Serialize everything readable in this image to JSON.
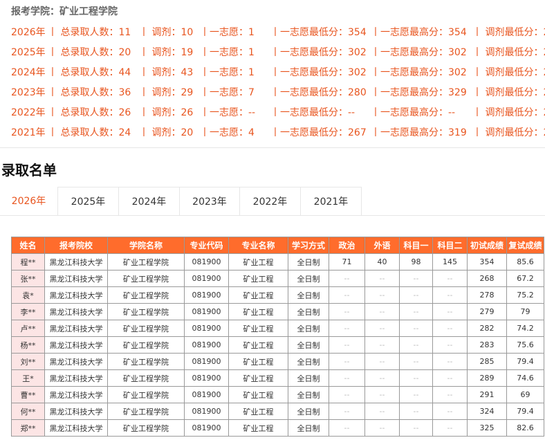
{
  "college_label": "报考学院：矿业工程学院",
  "summary": [
    {
      "year": "2026年",
      "total": "丨 总录取人数：11",
      "adjust": "丨 调剂：10",
      "first": "丨一志愿：1",
      "first_min": "丨一志愿最低分：354",
      "first_max": "丨一志愿最高分：354",
      "adjust_min": "丨 调剂最低分：2"
    },
    {
      "year": "2025年",
      "total": "丨 总录取人数：20",
      "adjust": "丨 调剂：19",
      "first": "丨一志愿：1",
      "first_min": "丨一志愿最低分：302",
      "first_max": "丨一志愿最高分：302",
      "adjust_min": "丨 调剂最低分：2"
    },
    {
      "year": "2024年",
      "total": "丨 总录取人数：44",
      "adjust": "丨 调剂：43",
      "first": "丨一志愿：1",
      "first_min": "丨一志愿最低分：302",
      "first_max": "丨一志愿最高分：302",
      "adjust_min": "丨 调剂最低分：2"
    },
    {
      "year": "2023年",
      "total": "丨 总录取人数：36",
      "adjust": "丨 调剂：29",
      "first": "丨一志愿：7",
      "first_min": "丨一志愿最低分：280",
      "first_max": "丨一志愿最高分：329",
      "adjust_min": "丨 调剂最低分：2"
    },
    {
      "year": "2022年",
      "total": "丨 总录取人数：26",
      "adjust": "丨 调剂：26",
      "first": "丨一志愿：--",
      "first_min": "丨一志愿最低分：--",
      "first_max": "丨一志愿最高分：--",
      "adjust_min": "丨 调剂最低分：2"
    },
    {
      "year": "2021年",
      "total": "丨 总录取人数：24",
      "adjust": "丨 调剂：20",
      "first": "丨一志愿：4",
      "first_min": "丨一志愿最低分：267",
      "first_max": "丨一志愿最高分：319",
      "adjust_min": "丨 调剂最低分：2"
    }
  ],
  "list_title": "录取名单",
  "tabs": [
    "2026年",
    "2025年",
    "2024年",
    "2023年",
    "2022年",
    "2021年"
  ],
  "active_tab": "2026年",
  "colors": {
    "accent": "#e8551f",
    "header_bg": "#ff6c2c",
    "name_bg": "#fce5e5"
  },
  "table": {
    "headers": [
      "姓名",
      "报考院校",
      "学院名称",
      "专业代码",
      "专业名称",
      "学习方式",
      "政治",
      "外语",
      "科目一",
      "科目二",
      "初试成绩",
      "复试成绩"
    ],
    "rows": [
      [
        "程**",
        "黑龙江科技大学",
        "矿业工程学院",
        "081900",
        "矿业工程",
        "全日制",
        "71",
        "40",
        "98",
        "145",
        "354",
        "85.6"
      ],
      [
        "张**",
        "黑龙江科技大学",
        "矿业工程学院",
        "081900",
        "矿业工程",
        "全日制",
        "--",
        "--",
        "--",
        "--",
        "268",
        "67.2"
      ],
      [
        "袁*",
        "黑龙江科技大学",
        "矿业工程学院",
        "081900",
        "矿业工程",
        "全日制",
        "--",
        "--",
        "--",
        "--",
        "278",
        "75.2"
      ],
      [
        "李**",
        "黑龙江科技大学",
        "矿业工程学院",
        "081900",
        "矿业工程",
        "全日制",
        "--",
        "--",
        "--",
        "--",
        "279",
        "79"
      ],
      [
        "卢**",
        "黑龙江科技大学",
        "矿业工程学院",
        "081900",
        "矿业工程",
        "全日制",
        "--",
        "--",
        "--",
        "--",
        "282",
        "74.2"
      ],
      [
        "杨**",
        "黑龙江科技大学",
        "矿业工程学院",
        "081900",
        "矿业工程",
        "全日制",
        "--",
        "--",
        "--",
        "--",
        "283",
        "75.6"
      ],
      [
        "刘**",
        "黑龙江科技大学",
        "矿业工程学院",
        "081900",
        "矿业工程",
        "全日制",
        "--",
        "--",
        "--",
        "--",
        "285",
        "79.4"
      ],
      [
        "王*",
        "黑龙江科技大学",
        "矿业工程学院",
        "081900",
        "矿业工程",
        "全日制",
        "--",
        "--",
        "--",
        "--",
        "289",
        "74.6"
      ],
      [
        "曹**",
        "黑龙江科技大学",
        "矿业工程学院",
        "081900",
        "矿业工程",
        "全日制",
        "--",
        "--",
        "--",
        "--",
        "291",
        "69"
      ],
      [
        "何**",
        "黑龙江科技大学",
        "矿业工程学院",
        "081900",
        "矿业工程",
        "全日制",
        "--",
        "--",
        "--",
        "--",
        "324",
        "79.4"
      ],
      [
        "郑**",
        "黑龙江科技大学",
        "矿业工程学院",
        "081900",
        "矿业工程",
        "全日制",
        "--",
        "--",
        "--",
        "--",
        "325",
        "82.6"
      ]
    ]
  }
}
